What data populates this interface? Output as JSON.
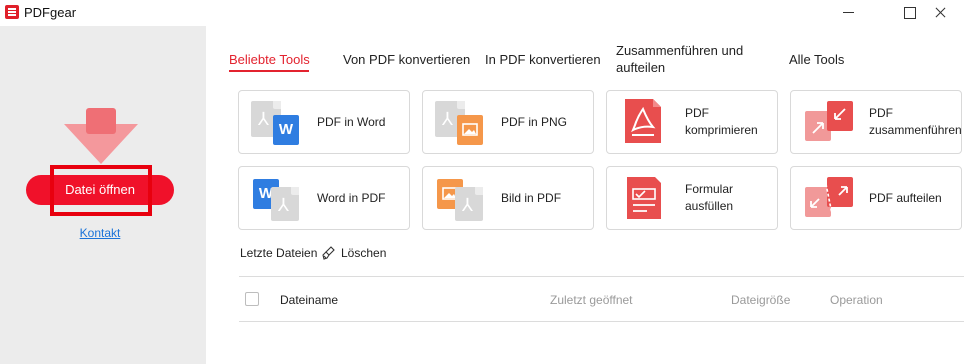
{
  "app": {
    "title": "PDFgear"
  },
  "sidebar": {
    "open_button": "Datei öffnen",
    "contact_link": "Kontakt"
  },
  "tabs": [
    {
      "label": "Beliebte Tools",
      "active": true
    },
    {
      "label": "Von PDF konvertieren",
      "active": false
    },
    {
      "label": "In PDF konvertieren",
      "active": false
    },
    {
      "label": "Zusammenführen und aufteilen",
      "active": false
    },
    {
      "label": "Alle Tools",
      "active": false
    }
  ],
  "tools": [
    {
      "label": "PDF in Word",
      "icon": "pdf-to-word-icon"
    },
    {
      "label": "PDF in PNG",
      "icon": "pdf-to-png-icon"
    },
    {
      "label": "PDF komprimieren",
      "icon": "compress-pdf-icon"
    },
    {
      "label": "PDF zusammenführen",
      "icon": "merge-pdf-icon"
    },
    {
      "label": "Word in PDF",
      "icon": "word-to-pdf-icon"
    },
    {
      "label": "Bild in PDF",
      "icon": "image-to-pdf-icon"
    },
    {
      "label": "Formular ausfüllen",
      "icon": "fill-form-icon"
    },
    {
      "label": "PDF aufteilen",
      "icon": "split-pdf-icon"
    }
  ],
  "recent": {
    "title": "Letzte Dateien",
    "clear_label": "Löschen",
    "columns": [
      "Dateiname",
      "Zuletzt geöffnet",
      "Dateigröße",
      "Operation"
    ]
  },
  "colors": {
    "accent": "#e3232f",
    "primary_button": "#f0112a",
    "word_blue": "#2f7de1",
    "image_orange": "#f5974a",
    "pdf_red": "#e84e4e",
    "sidebar_bg": "#ececec"
  }
}
